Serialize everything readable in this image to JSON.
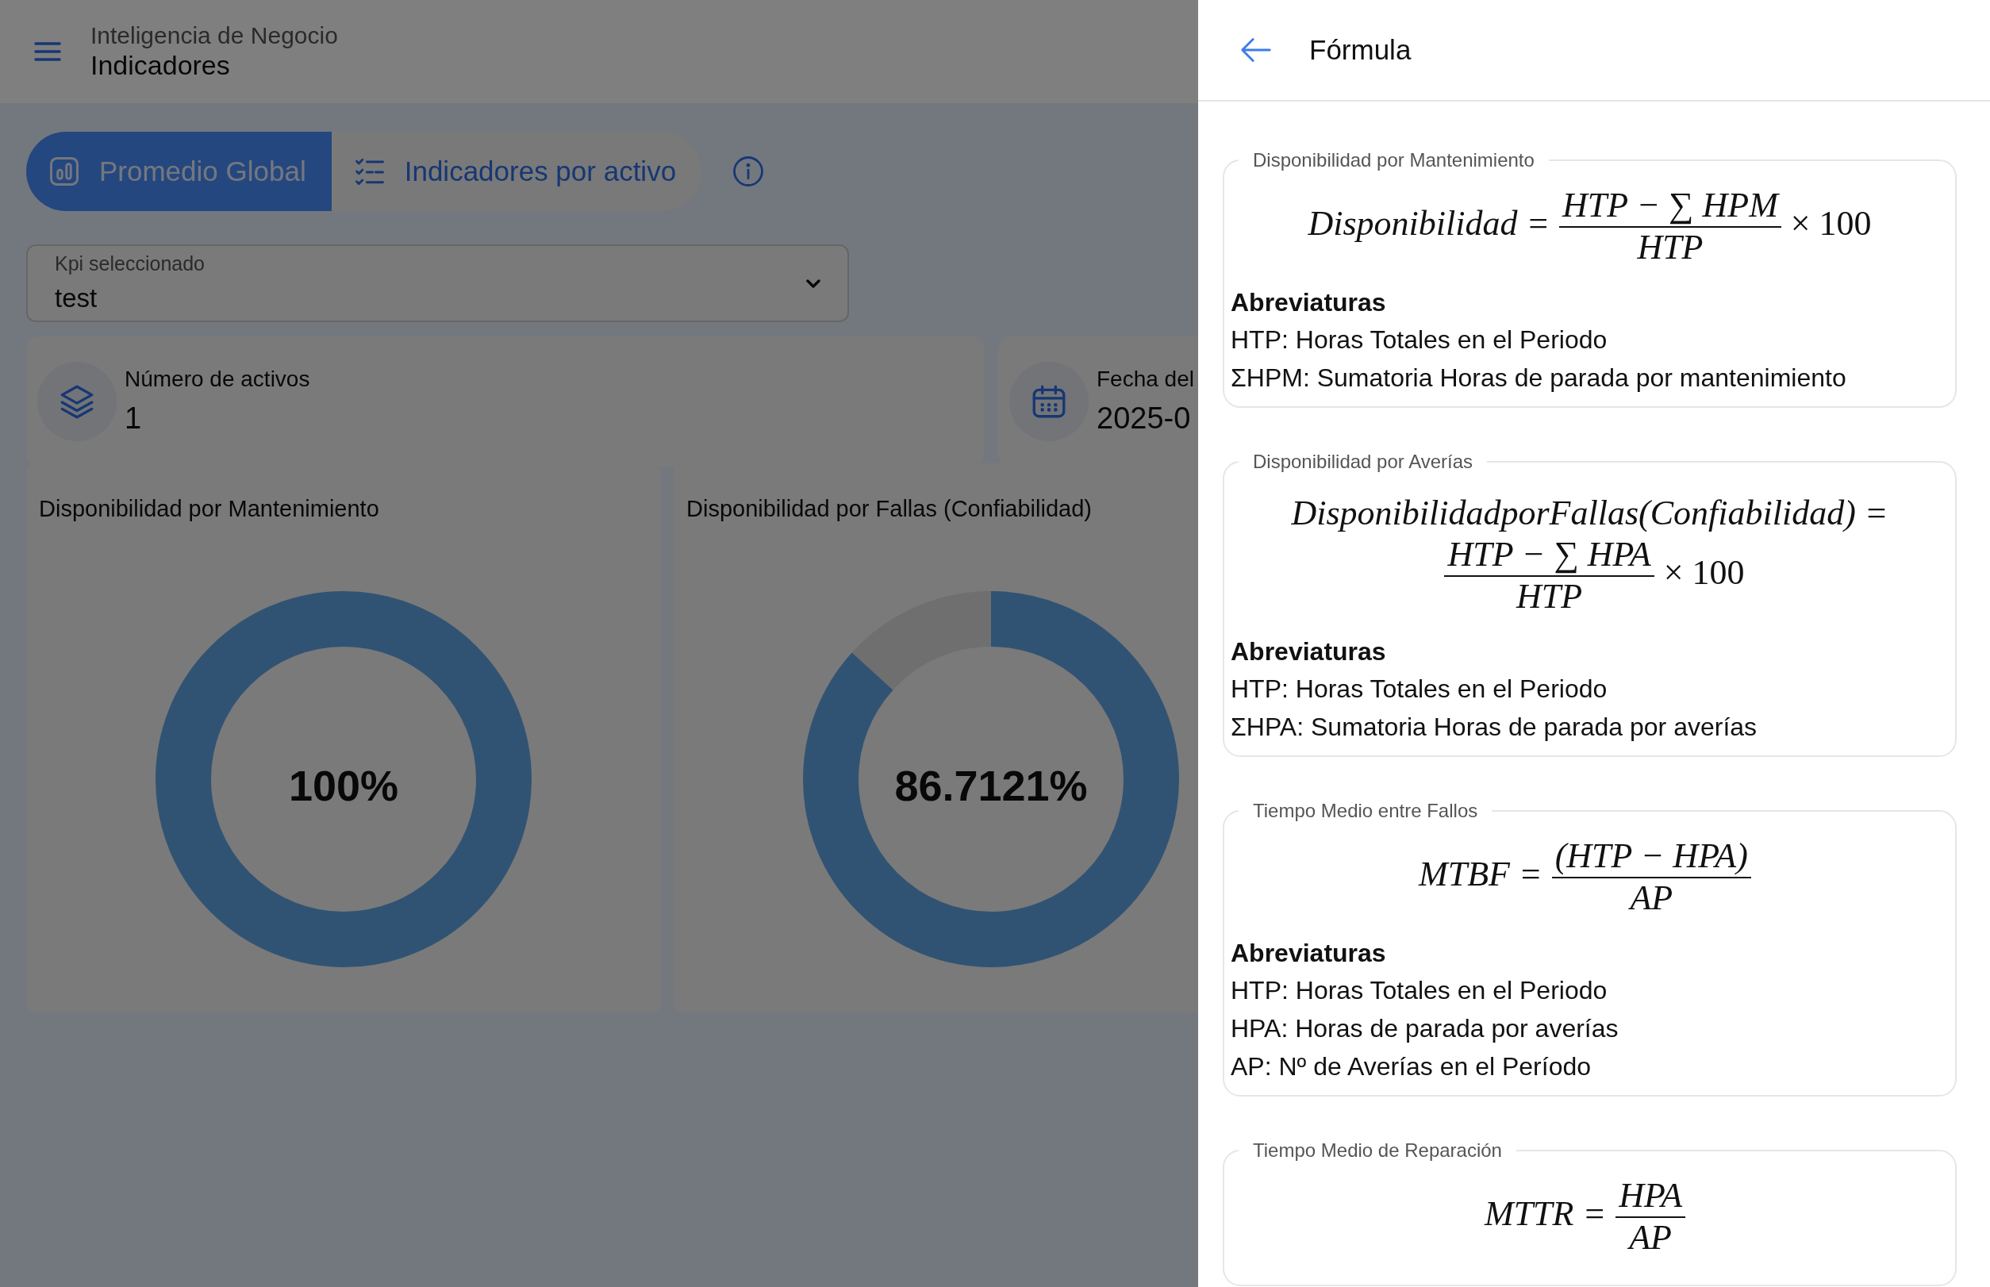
{
  "header": {
    "subtitle": "Inteligencia de Negocio",
    "title": "Indicadores"
  },
  "tabs": [
    {
      "label": "Promedio Global",
      "selected": true
    },
    {
      "label": "Indicadores por activo",
      "selected": false
    }
  ],
  "kpi_select": {
    "label": "Kpi seleccionado",
    "value": "test"
  },
  "stats": [
    {
      "kind": "count",
      "label": "Número de activos",
      "value": "1"
    },
    {
      "kind": "date",
      "label": "Fecha del",
      "value": "2025-0"
    }
  ],
  "gauges": [
    {
      "title": "Disponibilidad por Mantenimiento",
      "level": 1,
      "reading": "100%"
    },
    {
      "title": "Disponibilidad por Fallas (Confiabilidad)",
      "level": 0.867121,
      "reading": "86.7121%"
    }
  ],
  "drawer": {
    "title": "Fórmula",
    "sections": [
      {
        "legend": "Disponibilidad por Mantenimiento",
        "formula": {
          "kind": "inline",
          "lhs": "Disponibilidad =",
          "numerator": "HTP − ∑ HPM",
          "denominator": "HTP",
          "factor": "× 100"
        },
        "abbreviations_title": "Abreviaturas",
        "abbreviations": [
          "HTP: Horas Totales en el Periodo",
          "ΣHPM: Sumatoria Horas de parada por mantenimiento"
        ]
      },
      {
        "legend": "Disponibilidad por Averías",
        "formula": {
          "kind": "stacked",
          "lhs": "DisponibilidadporFallas(Confiabilidad) =",
          "numerator": "HTP − ∑ HPA",
          "denominator": "HTP",
          "factor": "× 100"
        },
        "abbreviations_title": "Abreviaturas",
        "abbreviations": [
          "HTP: Horas Totales en el Periodo",
          "ΣHPA: Sumatoria Horas de parada por averías"
        ]
      },
      {
        "legend": "Tiempo Medio entre Fallos",
        "formula": {
          "kind": "inline",
          "lhs": "MTBF =",
          "numerator": "(HTP − HPA)",
          "denominator": "AP"
        },
        "abbreviations_title": "Abreviaturas",
        "abbreviations": [
          "HTP: Horas Totales en el Periodo",
          "HPA: Horas de parada por averías",
          "AP: Nº de Averías en el Período"
        ]
      },
      {
        "legend": "Tiempo Medio de Reparación",
        "formula": {
          "kind": "inline",
          "lhs": "MTTR =",
          "numerator": "HPA",
          "denominator": "AP"
        }
      }
    ]
  }
}
